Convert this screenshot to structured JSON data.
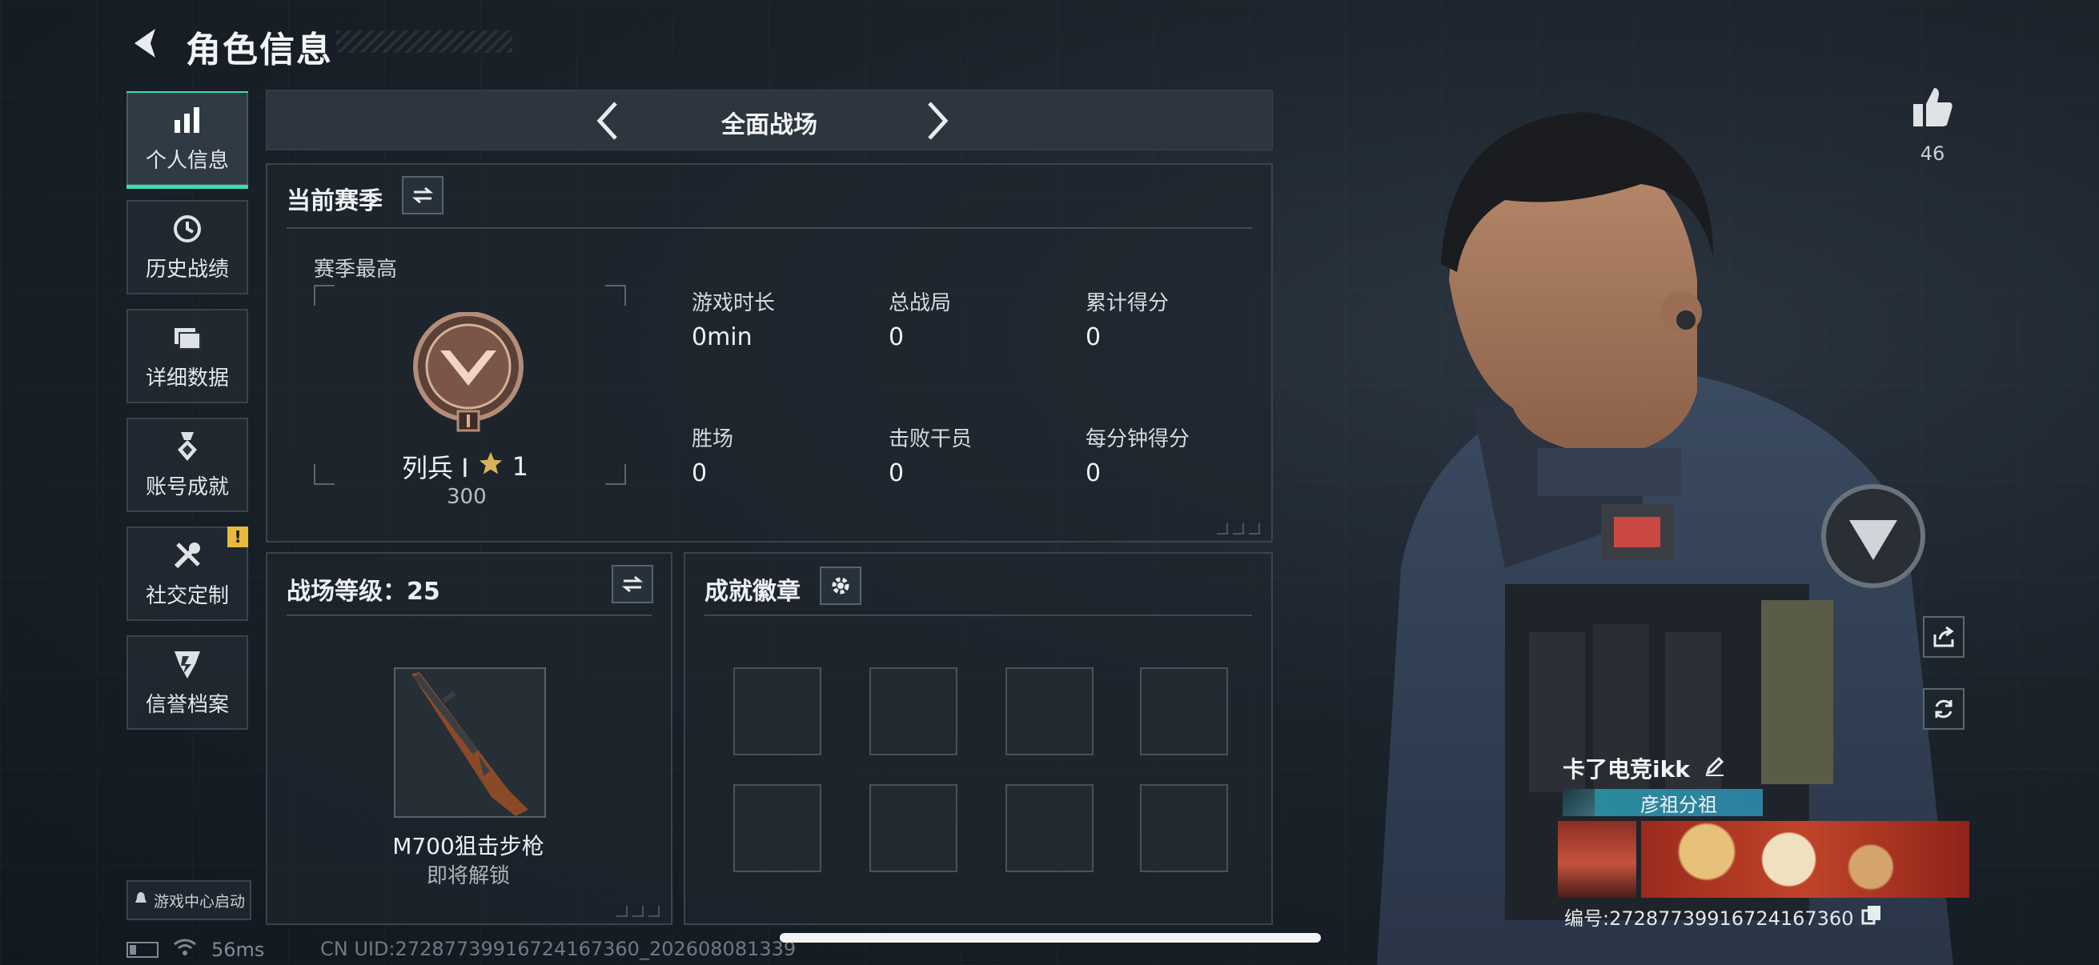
{
  "header": {
    "title": "角色信息"
  },
  "sidebar": {
    "items": [
      {
        "label": "个人信息",
        "icon": "bar-chart-icon",
        "active": true
      },
      {
        "label": "历史战绩",
        "icon": "history-icon",
        "active": false
      },
      {
        "label": "详细数据",
        "icon": "folder-icon",
        "active": false
      },
      {
        "label": "账号成就",
        "icon": "medal-icon",
        "active": false
      },
      {
        "label": "社交定制",
        "icon": "tools-icon",
        "active": false,
        "badge": "!"
      },
      {
        "label": "信誉档案",
        "icon": "reputation-icon",
        "active": false
      }
    ],
    "launch_label": "游戏中心启动"
  },
  "status": {
    "ping": "56ms",
    "uid_line": "CN UID:2728773991672416736​0_202608081339"
  },
  "mode": {
    "title": "全面战场"
  },
  "season": {
    "title": "当前赛季",
    "best_label": "赛季最高",
    "rank_name": "列兵 Ⅰ",
    "rank_stars": "1",
    "rank_points": "300",
    "stats": [
      {
        "label": "游戏时长",
        "value": "0min"
      },
      {
        "label": "总战局",
        "value": "0"
      },
      {
        "label": "累计得分",
        "value": "0"
      },
      {
        "label": "胜场",
        "value": "0"
      },
      {
        "label": "击败干员",
        "value": "0"
      },
      {
        "label": "每分钟得分",
        "value": "0"
      }
    ]
  },
  "battlefield_level": {
    "title": "战场等级：25",
    "weapon_name": "M700狙击步枪",
    "weapon_status": "即将解锁"
  },
  "achievements": {
    "title": "成就徽章",
    "slot_count": 8
  },
  "profile": {
    "likes": "46",
    "player_name": "卡了电竞ikk",
    "clan": "彦祖分祖",
    "player_uid": "编号:27287739916724167360"
  },
  "colors": {
    "accent": "#3fd9b4",
    "warning": "#e8b93a",
    "clan_bar": "#2a8c9a"
  }
}
